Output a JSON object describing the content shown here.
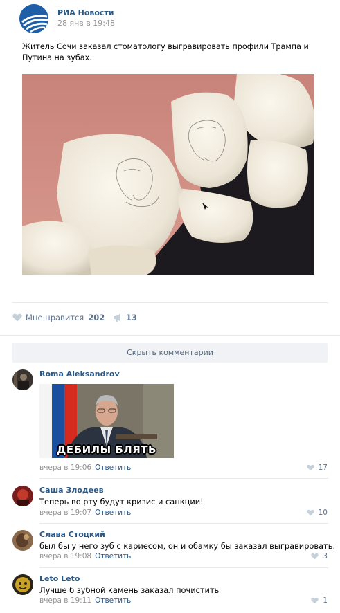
{
  "post": {
    "source_name": "РИА Новости",
    "date": "28 янв в 19:48",
    "text": "Житель Сочи заказал стоматологу выгравировать профили Трампа и Путина на зубах.",
    "likes_label": "Мне нравится",
    "likes_count": "202",
    "shares_count": "13",
    "hide_comments_label": "Скрыть комментарии"
  },
  "comments": [
    {
      "author": "Roma Aleksandrov",
      "text": "",
      "meme_caption": "ДЕБИЛЫ БЛЯТЬ",
      "time": "вчера в 19:06",
      "reply_label": "Ответить",
      "likes": "17"
    },
    {
      "author": "Саша Злодеев",
      "text": "Теперь во рту будут кризис и санкции!",
      "time": "вчера в 19:07",
      "reply_label": "Ответить",
      "likes": "10"
    },
    {
      "author": "Слава Стоцкий",
      "text": "был бы у него зуб с кариесом, он и обамку бы заказал выгравировать.",
      "time": "вчера в 19:08",
      "reply_label": "Ответить",
      "likes": "3"
    },
    {
      "author": "Leto Leto",
      "text": "Лучше б зубной камень заказал почистить",
      "time": "вчера в 19:11",
      "reply_label": "Ответить",
      "likes": "1"
    }
  ],
  "colors": {
    "link": "#2a5885",
    "meta": "#939393",
    "action": "#5e7390",
    "button_bg": "#f0f2f5"
  },
  "icons": [
    "ria-logo-icon",
    "heart-icon",
    "megaphone-icon"
  ]
}
